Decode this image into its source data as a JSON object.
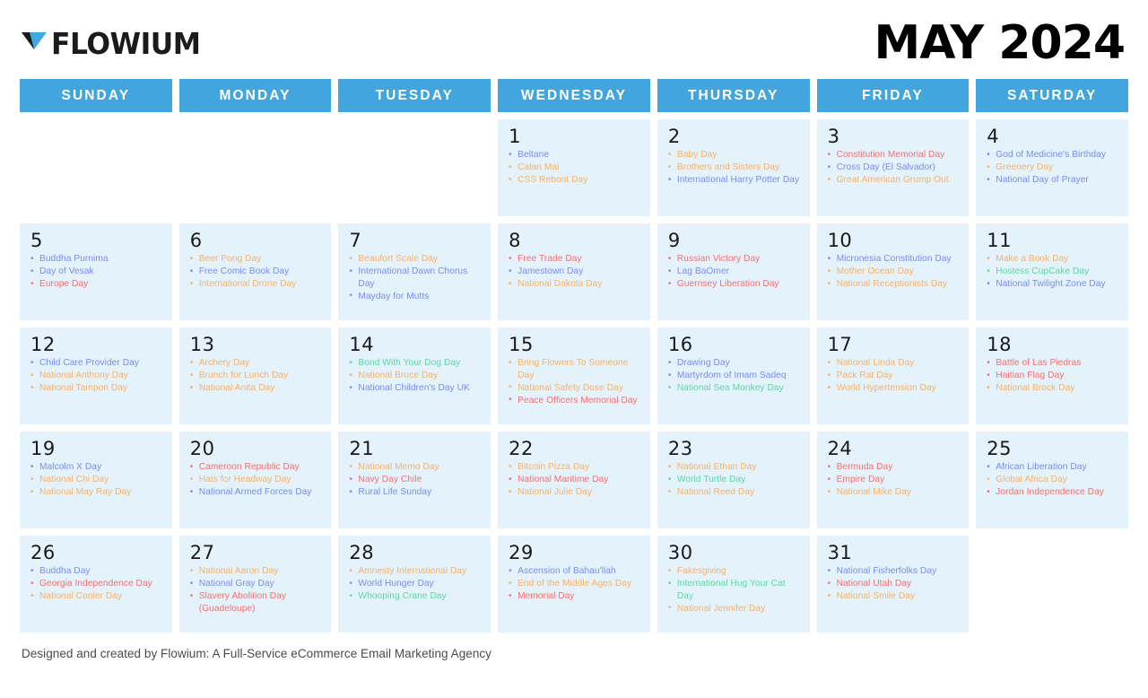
{
  "brand": {
    "name": "FLOWIUM",
    "logo_icon": "flowium-triangle-logo"
  },
  "header": {
    "month_title": "MAY 2024"
  },
  "weekdays": [
    "SUNDAY",
    "MONDAY",
    "TUESDAY",
    "WEDNESDAY",
    "THURSDAY",
    "FRIDAY",
    "SATURDAY"
  ],
  "colors": {
    "header_blue": "#42a5dd",
    "cell_background": "#e3f2fb",
    "event_blue": "#7b8cf0",
    "event_orange": "#f6b26b",
    "event_red": "#f4706f",
    "event_green": "#5fd6a4",
    "day_number": "#1a1a1a"
  },
  "footer": {
    "credit": "Designed and created by Flowium: A Full-Service eCommerce Email Marketing Agency"
  },
  "weeks": [
    [
      {
        "day": "",
        "events": []
      },
      {
        "day": "",
        "events": []
      },
      {
        "day": "",
        "events": []
      },
      {
        "day": "1",
        "events": [
          {
            "label": "Beltane",
            "color": "blue"
          },
          {
            "label": "Calan Mai",
            "color": "orange"
          },
          {
            "label": "CSS Reboot Day",
            "color": "orange"
          }
        ]
      },
      {
        "day": "2",
        "events": [
          {
            "label": "Baby Day",
            "color": "orange"
          },
          {
            "label": "Brothers and Sisters Day",
            "color": "orange"
          },
          {
            "label": "International Harry Potter Day",
            "color": "blue"
          }
        ]
      },
      {
        "day": "3",
        "events": [
          {
            "label": "Constitution Memorial Day",
            "color": "red"
          },
          {
            "label": "Cross Day (El Salvador)",
            "color": "blue"
          },
          {
            "label": "Great American Grump Out",
            "color": "orange"
          }
        ]
      },
      {
        "day": "4",
        "events": [
          {
            "label": "God of Medicine's Birthday",
            "color": "blue"
          },
          {
            "label": "Greenery Day",
            "color": "orange"
          },
          {
            "label": "National Day of Prayer",
            "color": "blue"
          }
        ]
      }
    ],
    [
      {
        "day": "5",
        "events": [
          {
            "label": "Buddha Purnima",
            "color": "blue"
          },
          {
            "label": "Day of Vesak",
            "color": "blue"
          },
          {
            "label": "Europe Day",
            "color": "red"
          }
        ]
      },
      {
        "day": "6",
        "events": [
          {
            "label": "Beer Pong Day",
            "color": "orange"
          },
          {
            "label": "Free Comic Book Day",
            "color": "blue"
          },
          {
            "label": "International Drone Day",
            "color": "orange"
          }
        ]
      },
      {
        "day": "7",
        "events": [
          {
            "label": "Beaufort Scale Day",
            "color": "orange"
          },
          {
            "label": "International Dawn Chorus Day",
            "color": "blue"
          },
          {
            "label": "Mayday for Mutts",
            "color": "blue"
          }
        ]
      },
      {
        "day": "8",
        "events": [
          {
            "label": "Free Trade Day",
            "color": "red"
          },
          {
            "label": "Jamestown Day",
            "color": "blue"
          },
          {
            "label": "National Dakota Day",
            "color": "orange"
          }
        ]
      },
      {
        "day": "9",
        "events": [
          {
            "label": "Russian Victory Day",
            "color": "red"
          },
          {
            "label": "Lag BaOmer",
            "color": "blue"
          },
          {
            "label": "Guernsey Liberation Day",
            "color": "red"
          }
        ]
      },
      {
        "day": "10",
        "events": [
          {
            "label": "Micronesia Constitution Day",
            "color": "blue"
          },
          {
            "label": "Mother Ocean Day",
            "color": "orange"
          },
          {
            "label": "National Receptionists Day",
            "color": "orange"
          }
        ]
      },
      {
        "day": "11",
        "events": [
          {
            "label": "Make a Book Day",
            "color": "orange"
          },
          {
            "label": "Hostess CupCake Day",
            "color": "green"
          },
          {
            "label": "National Twilight Zone Day",
            "color": "blue"
          }
        ]
      }
    ],
    [
      {
        "day": "12",
        "events": [
          {
            "label": "Child Care Provider Day",
            "color": "blue"
          },
          {
            "label": "National Anthony Day",
            "color": "orange"
          },
          {
            "label": "National Tampon Day",
            "color": "orange"
          }
        ]
      },
      {
        "day": "13",
        "events": [
          {
            "label": "Archery Day",
            "color": "orange"
          },
          {
            "label": "Brunch for Lunch Day",
            "color": "orange"
          },
          {
            "label": "National Anita Day",
            "color": "orange"
          }
        ]
      },
      {
        "day": "14",
        "events": [
          {
            "label": "Bond With Your Dog Day",
            "color": "green"
          },
          {
            "label": "National Bruce Day",
            "color": "orange"
          },
          {
            "label": "National Children's Day UK",
            "color": "blue"
          }
        ]
      },
      {
        "day": "15",
        "events": [
          {
            "label": "Bring Flowers To Someone Day",
            "color": "orange"
          },
          {
            "label": "National Safety Dose Day",
            "color": "orange"
          },
          {
            "label": "Peace Officers Memorial Day",
            "color": "red"
          }
        ]
      },
      {
        "day": "16",
        "events": [
          {
            "label": "Drawing Day",
            "color": "blue"
          },
          {
            "label": "Martyrdom of Imam Sadeq",
            "color": "blue"
          },
          {
            "label": "National Sea Monkey Day",
            "color": "green"
          }
        ]
      },
      {
        "day": "17",
        "events": [
          {
            "label": "National Linda Day",
            "color": "orange"
          },
          {
            "label": "Pack Rat Day",
            "color": "orange"
          },
          {
            "label": "World Hypertension Day",
            "color": "orange"
          }
        ]
      },
      {
        "day": "18",
        "events": [
          {
            "label": "Battle of Las Piedras",
            "color": "red"
          },
          {
            "label": "Haitian Flag Day",
            "color": "red"
          },
          {
            "label": "National Brock Day",
            "color": "orange"
          }
        ]
      }
    ],
    [
      {
        "day": "19",
        "events": [
          {
            "label": "Malcolm X Day",
            "color": "blue"
          },
          {
            "label": "National Chi Day",
            "color": "orange"
          },
          {
            "label": "National May Ray Day",
            "color": "orange"
          }
        ]
      },
      {
        "day": "20",
        "events": [
          {
            "label": "Cameroon Republic Day",
            "color": "red"
          },
          {
            "label": "Hats for Headway Day",
            "color": "orange"
          },
          {
            "label": "National Armed Forces Day",
            "color": "blue"
          }
        ]
      },
      {
        "day": "21",
        "events": [
          {
            "label": "National Memo Day",
            "color": "orange"
          },
          {
            "label": "Navy Day Chile",
            "color": "red"
          },
          {
            "label": "Rural Life Sunday",
            "color": "blue"
          }
        ]
      },
      {
        "day": "22",
        "events": [
          {
            "label": "Bitcoin Pizza Day",
            "color": "orange"
          },
          {
            "label": "National Maritime Day",
            "color": "red"
          },
          {
            "label": "National Julie Day",
            "color": "orange"
          }
        ]
      },
      {
        "day": "23",
        "events": [
          {
            "label": "National Ethan Day",
            "color": "orange"
          },
          {
            "label": "World Turtle Day",
            "color": "green"
          },
          {
            "label": "National Reed Day",
            "color": "orange"
          }
        ]
      },
      {
        "day": "24",
        "events": [
          {
            "label": "Bermuda Day",
            "color": "red"
          },
          {
            "label": "Empire Day",
            "color": "red"
          },
          {
            "label": "National Mike Day",
            "color": "orange"
          }
        ]
      },
      {
        "day": "25",
        "events": [
          {
            "label": "African Liberation Day",
            "color": "blue"
          },
          {
            "label": "Global Africa Day",
            "color": "orange"
          },
          {
            "label": "Jordan Independence Day",
            "color": "red"
          }
        ]
      }
    ],
    [
      {
        "day": "26",
        "events": [
          {
            "label": "Buddha Day",
            "color": "blue"
          },
          {
            "label": "Georgia Independence Day",
            "color": "red"
          },
          {
            "label": "National Cooler Day",
            "color": "orange"
          }
        ]
      },
      {
        "day": "27",
        "events": [
          {
            "label": "National Aaron Day",
            "color": "orange"
          },
          {
            "label": "National Gray Day",
            "color": "blue"
          },
          {
            "label": "Slavery Abolition Day (Guadeloupe)",
            "color": "red"
          }
        ]
      },
      {
        "day": "28",
        "events": [
          {
            "label": "Amnesty International Day",
            "color": "orange"
          },
          {
            "label": "World Hunger Day",
            "color": "blue"
          },
          {
            "label": "Whooping Crane Day",
            "color": "green"
          }
        ]
      },
      {
        "day": "29",
        "events": [
          {
            "label": "Ascension of Bahau'llah",
            "color": "blue"
          },
          {
            "label": "End of the Middle Ages Day",
            "color": "orange"
          },
          {
            "label": "Memorial Day",
            "color": "red"
          }
        ]
      },
      {
        "day": "30",
        "events": [
          {
            "label": "Fakesgiving",
            "color": "orange"
          },
          {
            "label": "International Hug Your Cat Day",
            "color": "green"
          },
          {
            "label": "National Jennifer Day",
            "color": "orange"
          }
        ]
      },
      {
        "day": "31",
        "events": [
          {
            "label": "National Fisherfolks Day",
            "color": "blue"
          },
          {
            "label": "National Utah Day",
            "color": "red"
          },
          {
            "label": "National Smile Day",
            "color": "orange"
          }
        ]
      },
      {
        "day": "",
        "events": []
      }
    ]
  ]
}
